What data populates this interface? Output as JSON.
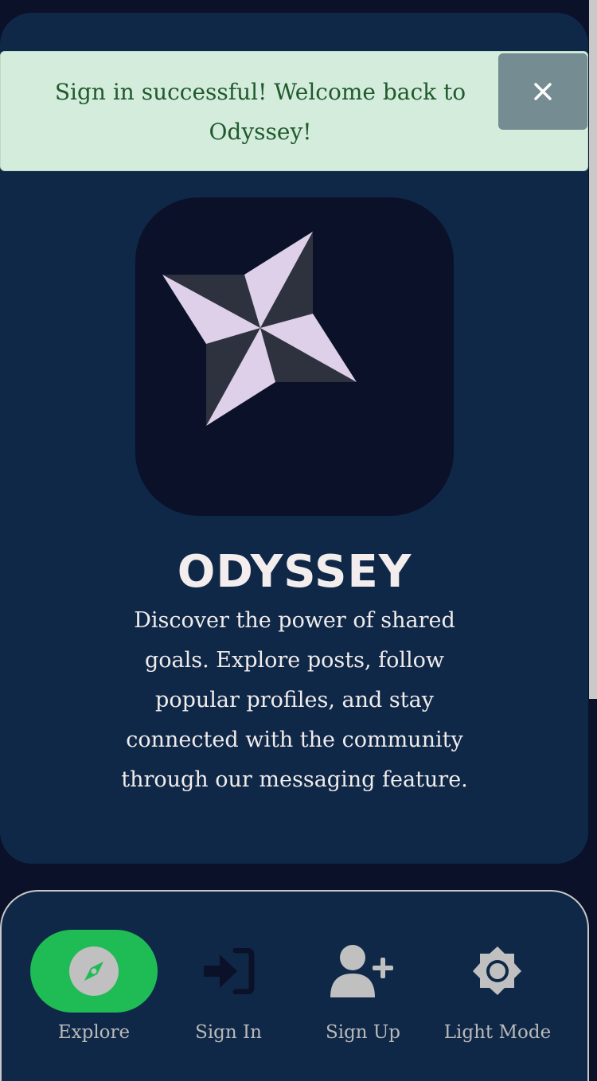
{
  "toast": {
    "message": "Sign in successful! Welcome back to Odyssey!",
    "close_icon": "close-icon"
  },
  "brand": {
    "logo_icon": "compass-star-icon",
    "title": "ODYSSEY",
    "description": "Discover the power of shared goals. Explore posts, follow popular profiles, and stay connected with the community through our messaging feature."
  },
  "nav": {
    "items": [
      {
        "label": "Explore",
        "icon": "compass-icon",
        "active": true
      },
      {
        "label": "Sign In",
        "icon": "sign-in-icon",
        "active": false
      },
      {
        "label": "Sign Up",
        "icon": "user-plus-icon",
        "active": false
      },
      {
        "label": "Light Mode",
        "icon": "sun-gear-icon",
        "active": false
      }
    ]
  },
  "colors": {
    "page_background": "#0a1128",
    "card_background": "#0f2847",
    "toast_background": "#d4ecdc",
    "toast_text": "#1f5a2c",
    "active_nav": "#1fbb55",
    "nav_label": "#b9b9b9",
    "logo_light": "#ddd0e8",
    "logo_dark": "#2e323f"
  }
}
